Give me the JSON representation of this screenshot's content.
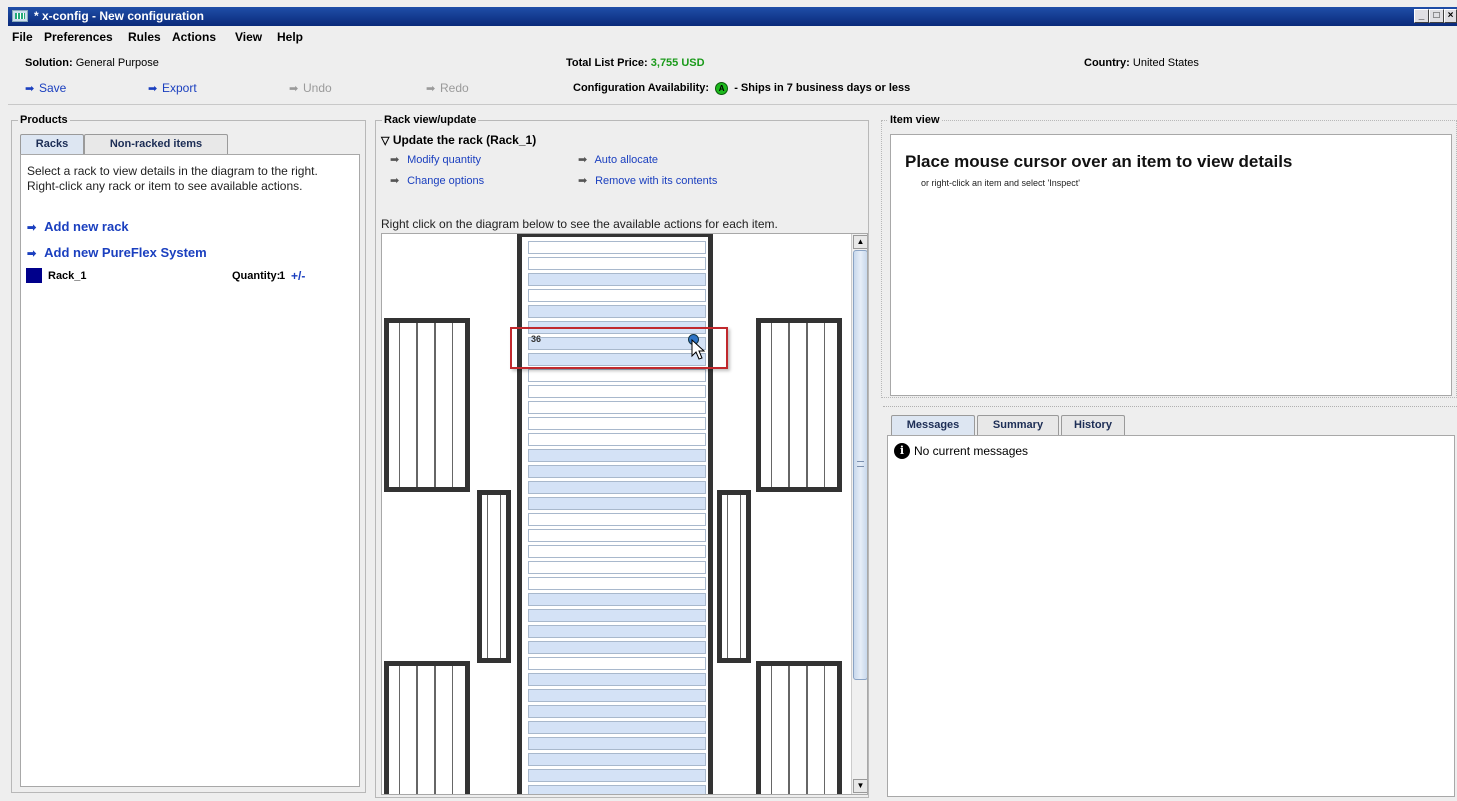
{
  "window": {
    "title": "* x-config - New configuration",
    "controls": [
      "_",
      "□",
      "×"
    ]
  },
  "menu": [
    "File",
    "Preferences",
    "Rules",
    "Actions",
    "View",
    "Help"
  ],
  "info": {
    "solution_label": "Solution:",
    "solution_value": "General Purpose",
    "price_label": "Total List Price:",
    "price_value": "3,755 USD",
    "country_label": "Country:",
    "country_value": "United States",
    "availability_label": "Configuration Availability:",
    "availability_badge": "A",
    "availability_text": "- Ships in 7 business days or less"
  },
  "toolbar": {
    "save": "Save",
    "export": "Export",
    "undo": "Undo",
    "redo": "Redo"
  },
  "products": {
    "title": "Products",
    "tabs": [
      "Racks",
      "Non-racked items"
    ],
    "help_text": "Select a rack to view details in the diagram to the right. Right-click any rack or item to see available actions.",
    "add_rack": "Add new rack",
    "add_pureflex": "Add new PureFlex System",
    "rack_name": "Rack_1",
    "quantity_label": "Quantity:",
    "quantity_value": "1",
    "qty_adjust": "+/-"
  },
  "rackview": {
    "title": "Rack view/update",
    "section_header": "Update the rack (Rack_1)",
    "actions": {
      "modify_quantity": "Modify quantity",
      "auto_allocate": "Auto allocate",
      "change_options": "Change options",
      "remove": "Remove with its contents"
    },
    "instructions": "Right click on the diagram below to see the available actions for each item.",
    "slot_label": "36"
  },
  "itemview": {
    "title": "Item view",
    "heading": "Place mouse cursor over an item to view details",
    "subtext": "or right-click an item and select 'Inspect'"
  },
  "messages": {
    "tabs": [
      "Messages",
      "Summary",
      "History"
    ],
    "text": "No current messages"
  },
  "colors": {
    "title_bar": "#0a2a7a",
    "price_green": "#1a9a1a",
    "link_blue": "#1a3fbf",
    "rack_swatch": "#00008b",
    "highlight_red": "#c0282d"
  }
}
